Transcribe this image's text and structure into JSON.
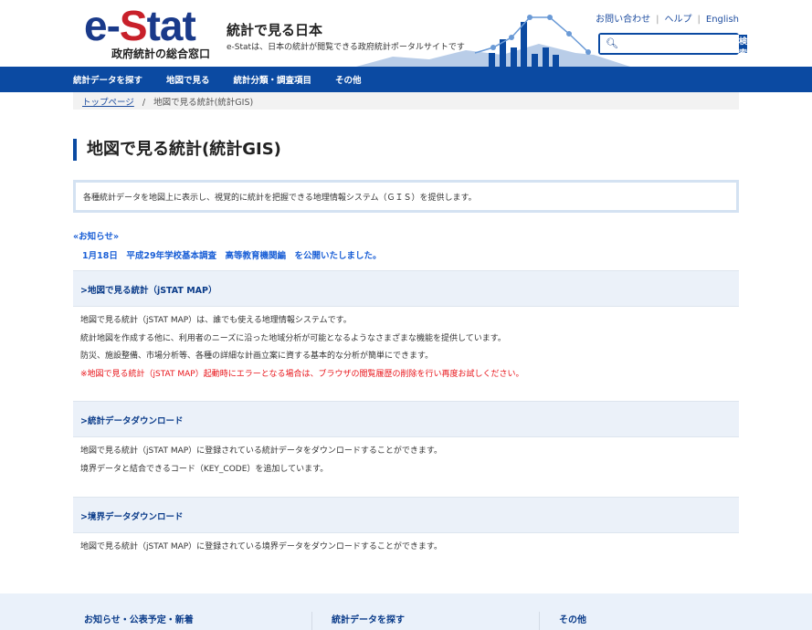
{
  "header": {
    "logo_main_1": "e-",
    "logo_main_2": "S",
    "logo_main_3": "tat",
    "logo_sub": "政府統計の総合窓口",
    "site_title": "統計で見る日本",
    "site_desc": "e-Statは、日本の統計が閲覧できる政府統計ポータルサイトです",
    "links": [
      "お問い合わせ",
      "ヘルプ",
      "English"
    ],
    "separator": "|",
    "search_button": "検索",
    "search_value": ""
  },
  "nav": [
    "統計データを探す",
    "地図で見る",
    "統計分類・調査項目",
    "その他"
  ],
  "breadcrumb": {
    "home": "トップページ",
    "sep": "/",
    "current": "地図で見る統計(統計GIS)"
  },
  "page_title": "地図で見る統計(統計GIS)",
  "intro": "各種統計データを地図上に表示し、視覚的に統計を把握できる地理情報システム（ＧＩＳ）を提供します。",
  "news": {
    "heading": "«お知らせ»",
    "item": "1月18日　平成29年学校基本調査　高等教育機関編　を公開いたしました。"
  },
  "sections": [
    {
      "title": ">地図で見る統計（jSTAT MAP）",
      "lines": [
        "地図で見る統計（jSTAT MAP）は、誰でも使える地理情報システムです。",
        "統計地図を作成する他に、利用者のニーズに沿った地域分析が可能となるようなさまざまな機能を提供しています。",
        "防災、施設整備、市場分析等、各種の詳細な計画立案に資する基本的な分析が簡単にできます。"
      ],
      "warning": "※地図で見る統計（jSTAT MAP）起動時にエラーとなる場合は、ブラウザの閲覧履歴の削除を行い再度お試しください。"
    },
    {
      "title": ">統計データダウンロード",
      "lines": [
        "地図で見る統計（jSTAT MAP）に登録されている統計データをダウンロードすることができます。",
        "境界データと結合できるコード（KEY_CODE）を追加しています。"
      ]
    },
    {
      "title": ">境界データダウンロード",
      "lines": [
        "地図で見る統計（jSTAT MAP）に登録されている境界データをダウンロードすることができます。"
      ]
    }
  ],
  "footer": [
    "お知らせ・公表予定・新着",
    "統計データを探す",
    "その他"
  ],
  "colors": {
    "brand": "#0b4aa2",
    "logo_red": "#c8202a",
    "warning": "#e8141a",
    "link": "#1a5fd6"
  }
}
